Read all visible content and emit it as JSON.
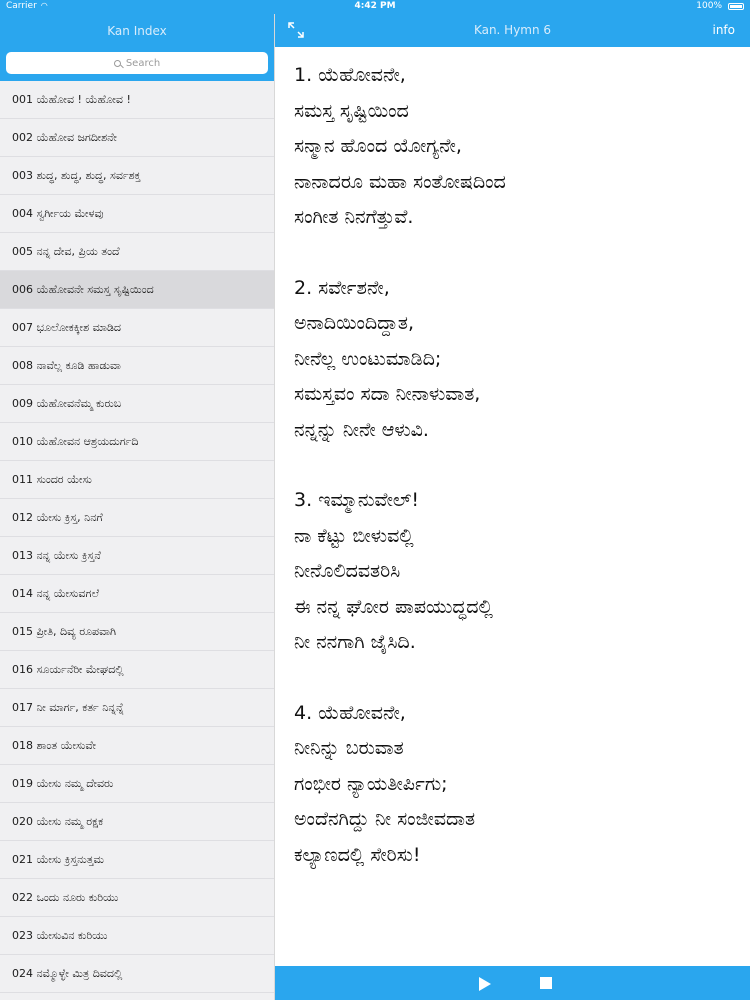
{
  "status_bar": {
    "carrier": "Carrier",
    "time": "4:42 PM",
    "battery": "100%"
  },
  "sidebar": {
    "title": "Kan Index",
    "search_placeholder": "Search",
    "selected_index": 5,
    "items": [
      "001 ಯೆಹೋವ ! ಯೆಹೋವ !",
      "002 ಯೆಹೋವ ಜಗದೀಶನೇ",
      "003 ಶುದ್ಧ, ಶುದ್ಧ, ಶುದ್ಧ, ಸರ್ವಶಕ್ತ",
      "004 ಸ್ವರ್ಗೀಯ ಮೇಳವು",
      "005 ನನ್ನ ದೇವ, ಪ್ರಿಯ ತಂದೆ",
      "006 ಯೆಹೋವನೇ ಸಮಸ್ತ ಸೃಷ್ಟಿಯಿಂದ",
      "007 ಭೂಲೋಕಕ್ಕೀಶ ಮಾಡಿದ",
      "008 ನಾವೆಲ್ಲ ಕೂಡಿ ಹಾಡುವಾ",
      "009 ಯೆಹೋವನೆಮ್ಮ ಕುರುಬ",
      "010 ಯೆಹೋವನ ಆಶ್ರಯದುರ್ಗದಿ",
      "011 ಸುಂದರ ಯೇಸು",
      "012 ಯೇಸು ಕ್ರಿಸ್ತ, ನಿನಗೆ",
      "013 ನನ್ನ ಯೇಸು ಕ್ರಿಸ್ತನೆ",
      "014 ನನ್ನ ಯೇಸುವಗಲೆ",
      "015 ಪ್ರೀತಿ, ದಿವ್ಯ ರೂಪವಾಗಿ",
      "016 ಸೂರ್ಯನೆರೀ ಮೇಘದಲ್ಲಿ",
      "017 ನೀ ಮಾರ್ಗ, ಕರ್ತ ನಿನ್ನನ್ನೆ",
      "018 ಶಾಂತ ಯೇಸುವೇ",
      "019 ಯೇಸು ನಮ್ಮ ದೇವರು",
      "020 ಯೇಸು ನಮ್ಮ ರಕ್ಷಕ",
      "021 ಯೇಸು ಕ್ರಿಸ್ತನುತ್ತಮ",
      "022 ಒಂದು ನೂರು ಕುರಿಯು",
      "023 ಯೇಸುವಿನ ಕುರಿಯು",
      "024 ನಮ್ಮೊಳ್ಳೇ ಮಿತ್ರ ದಿವದಲ್ಲಿ"
    ]
  },
  "detail": {
    "title": "Kan. Hymn 6",
    "info_label": "info",
    "verses": [
      [
        "1. ಯೆಹೋವನೇ,",
        "ಸಮಸ್ತ ಸೃಷ್ಟಿಯಿಂದ",
        "ಸನ್ಮಾನ ಹೊಂದ ಯೋಗ್ಯನೇ,",
        "ನಾನಾದರೂ ಮಹಾ ಸಂತೋಷದಿಂದ",
        "ಸಂಗೀತ ನಿನಗೆತ್ತುವೆ."
      ],
      [
        "2. ಸರ್ವೇಶನೇ,",
        "ಅನಾದಿಯಿಂದಿದ್ದಾತ,",
        "ನೀನೆಲ್ಲ ಉಂಟುಮಾಡಿದಿ;",
        "ಸಮಸ್ತವಂ ಸದಾ ನೀನಾಳುವಾತ,",
        "ನನ್ನನ್ನು ನೀನೇ ಆಳುವಿ."
      ],
      [
        "3. ಇಮ್ಮಾನುವೇಲ್!",
        "ನಾ ಕೆಟ್ಟು ಬೀಳುವಲ್ಲಿ",
        "ನೀನೊಲಿದವತರಿಸಿ",
        "ಈ ನನ್ನ ಘೋರ ಪಾಪಯುದ್ಧದಲ್ಲಿ",
        "ನೀ ನನಗಾಗಿ ಜೈಸಿದಿ."
      ],
      [
        "4. ಯೆಹೋವನೇ,",
        "ನೀನಿನ್ನು ಬರುವಾತ",
        "ಗಂಭೀರ ನ್ಯಾಯತೀರ್ಪಿಗು;",
        "ಅಂದೆನಗಿದ್ದು ನೀ ಸಂಜೀವದಾತ",
        "ಕಲ್ಯಾಣದಲ್ಲಿ ಸೇರಿಸು!"
      ]
    ]
  },
  "icons": {
    "expand": "expand-icon",
    "play": "play-icon",
    "stop": "stop-icon",
    "search": "search-icon"
  },
  "colors": {
    "accent": "#2aa6ee",
    "selected_row": "#d9d9dc",
    "sidebar_bg": "#f0f0f2"
  }
}
